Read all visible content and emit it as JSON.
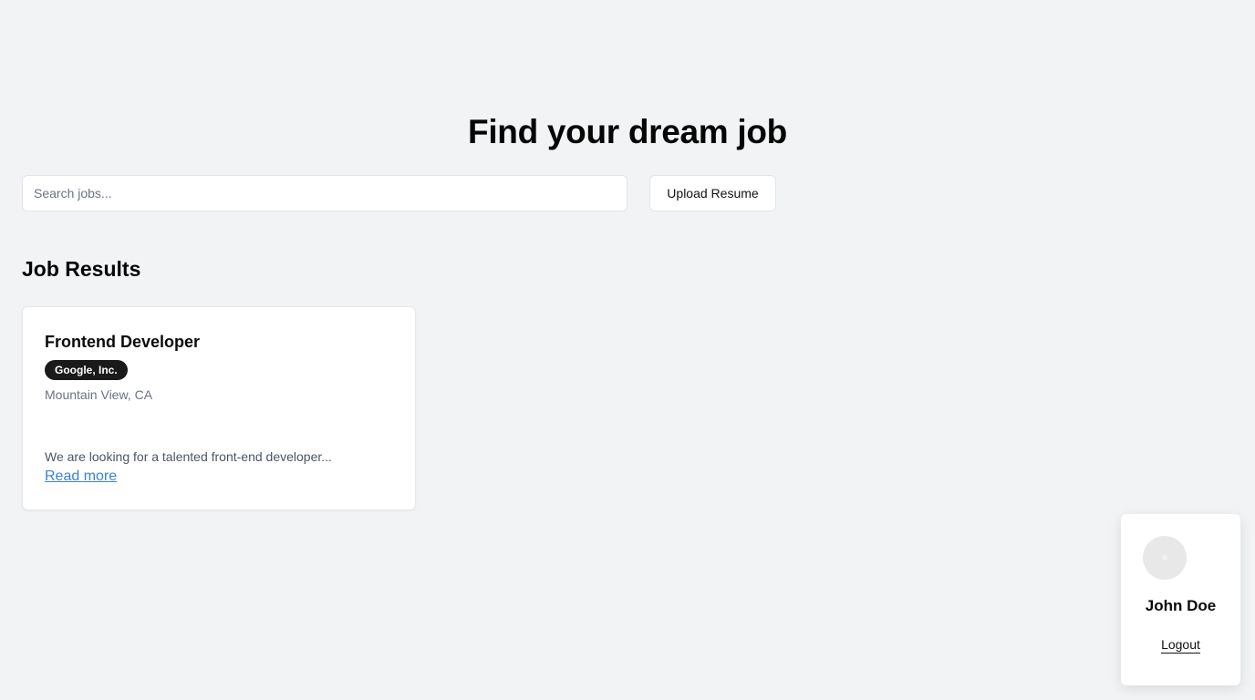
{
  "hero": {
    "title": "Find your dream job"
  },
  "search": {
    "placeholder": "Search jobs...",
    "value": ""
  },
  "toolbar": {
    "upload_label": "Upload Resume"
  },
  "results": {
    "title": "Job Results",
    "jobs": [
      {
        "title": "Frontend Developer",
        "company": "Google, Inc.",
        "location": "Mountain View, CA",
        "description": "We are looking for a talented front-end developer...",
        "read_more_label": "Read more"
      }
    ]
  },
  "profile": {
    "name": "John Doe",
    "logout_label": "Logout",
    "avatar_icon": "user-avatar-icon"
  },
  "colors": {
    "background": "#f2f3f5",
    "link": "#3b82d6",
    "badge_bg": "#1a1a1a"
  }
}
